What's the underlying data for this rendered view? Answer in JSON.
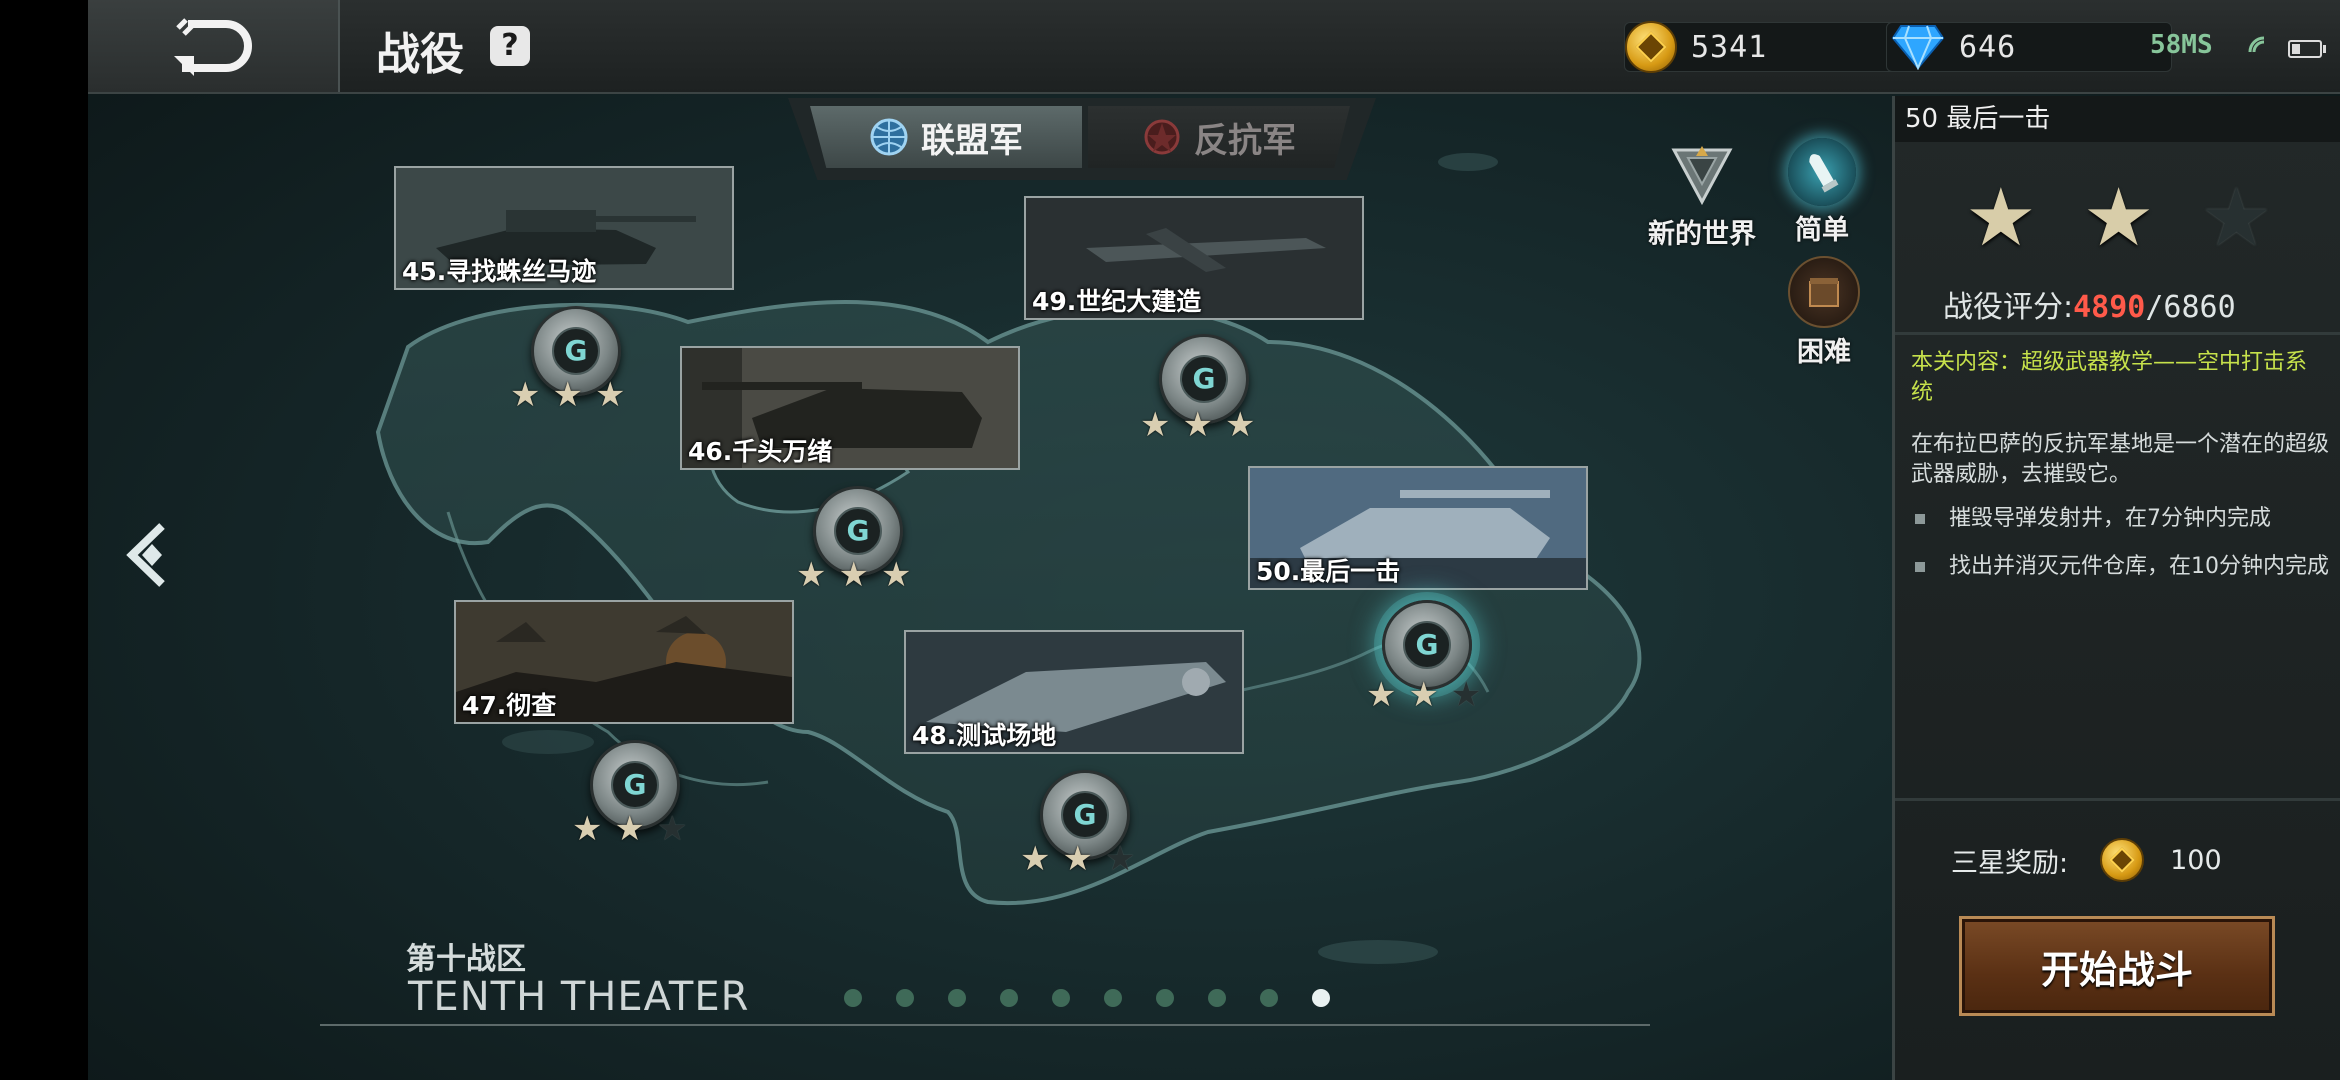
{
  "header": {
    "title": "战役",
    "help_label": "?",
    "gold": "5341",
    "diamonds": "646",
    "ping": "58MS"
  },
  "tabs": [
    {
      "label": "联盟军",
      "active": true
    },
    {
      "label": "反抗军",
      "active": false
    }
  ],
  "modes": [
    {
      "label": "新的世界"
    },
    {
      "label": "简单",
      "selected": true
    },
    {
      "label": "困难"
    }
  ],
  "missions": [
    {
      "label": "45.寻找蛛丝马迹",
      "stars": 3
    },
    {
      "label": "46.千头万绪",
      "stars": 3
    },
    {
      "label": "47.彻查",
      "stars": 2
    },
    {
      "label": "48.测试场地",
      "stars": 2
    },
    {
      "label": "49.世纪大建造",
      "stars": 3
    },
    {
      "label": "50.最后一击",
      "stars": 2,
      "current": true
    }
  ],
  "theater": {
    "zh": "第十战区",
    "en": "TENTH THEATER",
    "page_count": 10,
    "active_page": 10
  },
  "panel": {
    "mission_title": "50 最后一击",
    "stars": 2,
    "score_label": "战役评分:",
    "score": "4890",
    "score_sep": "/",
    "score_max": "6860",
    "content_title": "本关内容：超级武器教学——空中打击系统",
    "description": "在布拉巴萨的反抗军基地是一个潜在的超级武器威胁，去摧毁它。",
    "objectives": [
      "摧毁导弹发射井，在7分钟内完成",
      "找出并消灭元件仓库，在10分钟内完成"
    ],
    "reward_label": "三星奖励:",
    "reward_value": "100",
    "start_label": "开始战斗"
  },
  "colors": {
    "score_current": "#ff5a4a",
    "content_title": "#c6e14b",
    "start_button": "#6a3a1a"
  }
}
